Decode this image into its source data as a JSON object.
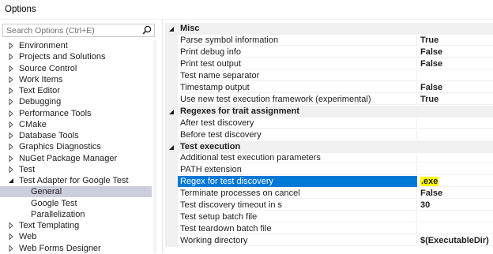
{
  "window": {
    "title": "Options"
  },
  "search": {
    "placeholder": "Search Options (Ctrl+E)"
  },
  "tree": {
    "items": [
      {
        "label": "Environment",
        "level": 0,
        "expanded": false,
        "selected": false
      },
      {
        "label": "Projects and Solutions",
        "level": 0,
        "expanded": false,
        "selected": false
      },
      {
        "label": "Source Control",
        "level": 0,
        "expanded": false,
        "selected": false
      },
      {
        "label": "Work Items",
        "level": 0,
        "expanded": false,
        "selected": false
      },
      {
        "label": "Text Editor",
        "level": 0,
        "expanded": false,
        "selected": false
      },
      {
        "label": "Debugging",
        "level": 0,
        "expanded": false,
        "selected": false
      },
      {
        "label": "Performance Tools",
        "level": 0,
        "expanded": false,
        "selected": false
      },
      {
        "label": "CMake",
        "level": 0,
        "expanded": false,
        "selected": false
      },
      {
        "label": "Database Tools",
        "level": 0,
        "expanded": false,
        "selected": false
      },
      {
        "label": "Graphics Diagnostics",
        "level": 0,
        "expanded": false,
        "selected": false
      },
      {
        "label": "NuGet Package Manager",
        "level": 0,
        "expanded": false,
        "selected": false
      },
      {
        "label": "Test",
        "level": 0,
        "expanded": false,
        "selected": false
      },
      {
        "label": "Test Adapter for Google Test",
        "level": 0,
        "expanded": true,
        "selected": false
      },
      {
        "label": "General",
        "level": 1,
        "expanded": false,
        "selected": true
      },
      {
        "label": "Google Test",
        "level": 1,
        "expanded": false,
        "selected": false
      },
      {
        "label": "Parallelization",
        "level": 1,
        "expanded": false,
        "selected": false
      },
      {
        "label": "Text Templating",
        "level": 0,
        "expanded": false,
        "selected": false
      },
      {
        "label": "Web",
        "level": 0,
        "expanded": false,
        "selected": false
      },
      {
        "label": "Web Forms Designer",
        "level": 0,
        "expanded": false,
        "selected": false
      }
    ]
  },
  "grid": {
    "categories": [
      {
        "name": "Misc",
        "properties": [
          {
            "name": "Parse symbol information",
            "value": "True"
          },
          {
            "name": "Print debug info",
            "value": "False"
          },
          {
            "name": "Print test output",
            "value": "False"
          },
          {
            "name": "Test name separator",
            "value": ""
          },
          {
            "name": "Timestamp output",
            "value": "False"
          },
          {
            "name": "Use new test execution framework (experimental)",
            "value": "True"
          }
        ]
      },
      {
        "name": "Regexes for trait assignment",
        "properties": [
          {
            "name": "After test discovery",
            "value": ""
          },
          {
            "name": "Before test discovery",
            "value": ""
          }
        ]
      },
      {
        "name": "Test execution",
        "properties": [
          {
            "name": "Additional test execution parameters",
            "value": ""
          },
          {
            "name": "PATH extension",
            "value": ""
          },
          {
            "name": "Regex for test discovery",
            "value": ".exe",
            "selected": true,
            "highlight": true
          },
          {
            "name": "Terminate processes on cancel",
            "value": "False"
          },
          {
            "name": "Test discovery timeout in s",
            "value": "30"
          },
          {
            "name": "Test setup batch file",
            "value": ""
          },
          {
            "name": "Test teardown batch file",
            "value": ""
          },
          {
            "name": "Working directory",
            "value": "$(ExecutableDir)"
          }
        ]
      }
    ]
  },
  "colors": {
    "selection": "#0078d7",
    "tree_selection": "#cccedb",
    "highlight": "#ffff00",
    "category_bg": "#f0f0f0"
  },
  "icons": {
    "search": "search-icon",
    "collapsed": "chevron-right-icon",
    "expanded": "chevron-down-icon"
  }
}
